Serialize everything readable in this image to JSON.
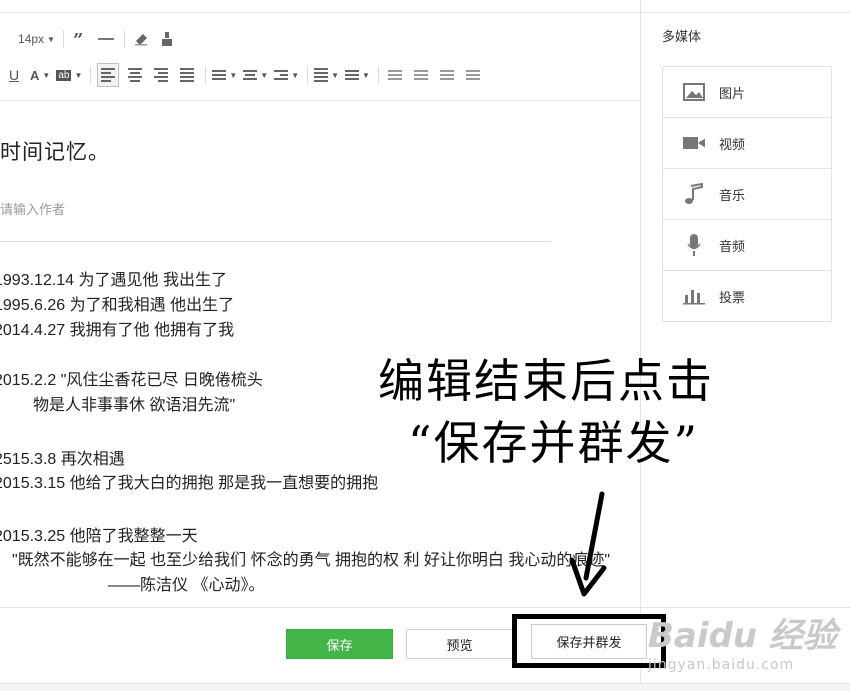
{
  "toolbar": {
    "font_size": "14px"
  },
  "article": {
    "title": "时间记忆。",
    "author_placeholder": "请输入作者",
    "lines": [
      "1993.12.14  为了遇见他  我出生了",
      "1995.6.26   为了和我相遇  他出生了",
      "2014.4.27   我拥有了他 他拥有了我",
      "2015.2.2   \"风住尘香花已尽 日晚倦梳头",
      "物是人非事事休 欲语泪先流\"",
      "2515.3.8     再次相遇",
      "2015.3.15    他给了我大白的拥抱 那是我一直想要的拥抱",
      "2015.3.25    他陪了我整整一天",
      "\"既然不能够在一起 也至少给我们 怀念的勇气 拥抱的权 利 好让你明白 我心动的痕迹\"",
      "——陈洁仪 《心动》。"
    ]
  },
  "sidebar": {
    "title": "多媒体",
    "items": [
      {
        "label": "图片",
        "icon": "image-icon"
      },
      {
        "label": "视频",
        "icon": "video-icon"
      },
      {
        "label": "音乐",
        "icon": "music-icon"
      },
      {
        "label": "音频",
        "icon": "microphone-icon"
      },
      {
        "label": "投票",
        "icon": "poll-icon"
      }
    ]
  },
  "buttons": {
    "save": "保存",
    "preview": "预览",
    "save_publish": "保存并群发"
  },
  "annotation": {
    "line1": "编辑结束后点击",
    "line2": "“保存并群发”"
  },
  "watermark": {
    "brand": "Baidu 经验",
    "url": "jingyan.baidu.com"
  },
  "colors": {
    "save_button": "#44b549",
    "border": "#e3e3e3"
  }
}
